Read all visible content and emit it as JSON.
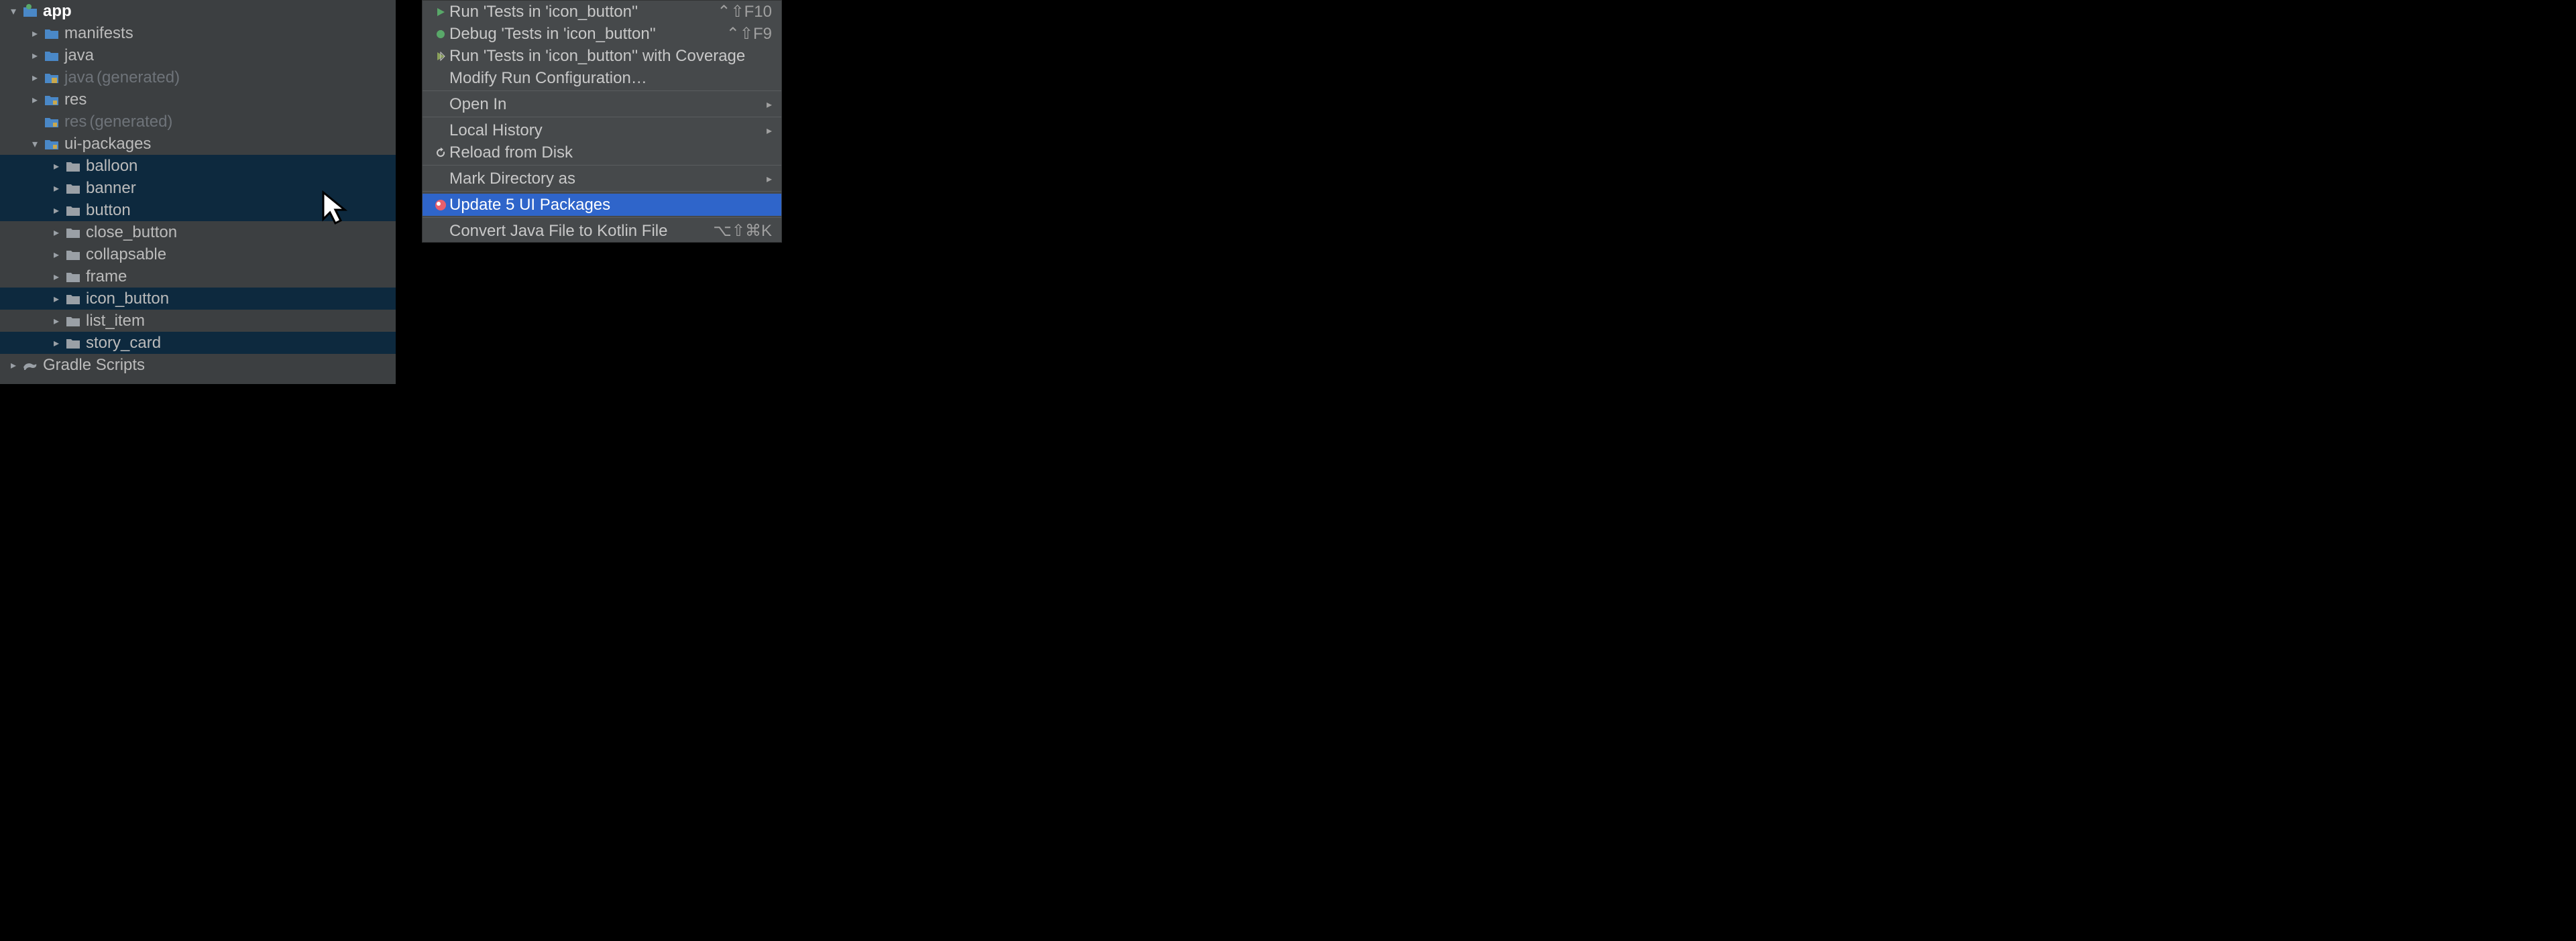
{
  "tree": {
    "root": {
      "label": "app"
    },
    "items": [
      {
        "label": "manifests",
        "chev": "right",
        "kind": "folder-blue"
      },
      {
        "label": "java",
        "chev": "right",
        "kind": "folder-blue"
      },
      {
        "label": "java",
        "suffix": "(generated)",
        "chev": "right",
        "kind": "folder-gen"
      },
      {
        "label": "res",
        "chev": "right",
        "kind": "folder-res"
      },
      {
        "label": "res",
        "suffix": "(generated)",
        "chev": "none",
        "kind": "folder-res",
        "muted": true
      },
      {
        "label": "ui-packages",
        "chev": "down",
        "kind": "folder-res"
      }
    ],
    "packages": [
      {
        "label": "balloon"
      },
      {
        "label": "banner"
      },
      {
        "label": "button"
      },
      {
        "label": "close_button"
      },
      {
        "label": "collapsable"
      },
      {
        "label": "frame"
      },
      {
        "label": "icon_button"
      },
      {
        "label": "list_item"
      },
      {
        "label": "story_card"
      }
    ],
    "gradle": {
      "label": "Gradle Scripts"
    }
  },
  "menu": {
    "run": {
      "label": "Run 'Tests in 'icon_button''",
      "shortcut": "⌃⇧F10"
    },
    "debug": {
      "label": "Debug 'Tests in 'icon_button''",
      "shortcut": "⌃⇧F9"
    },
    "coverage": {
      "label": "Run 'Tests in 'icon_button'' with Coverage"
    },
    "modify": {
      "label": "Modify Run Configuration…"
    },
    "open_in": {
      "label": "Open In"
    },
    "local_hist": {
      "label": "Local History"
    },
    "reload": {
      "label": "Reload from Disk"
    },
    "mark_dir": {
      "label": "Mark Directory as"
    },
    "update_pkgs": {
      "label": "Update 5 UI Packages"
    },
    "convert": {
      "label": "Convert Java File to Kotlin File",
      "shortcut": "⌥⇧⌘K"
    }
  }
}
